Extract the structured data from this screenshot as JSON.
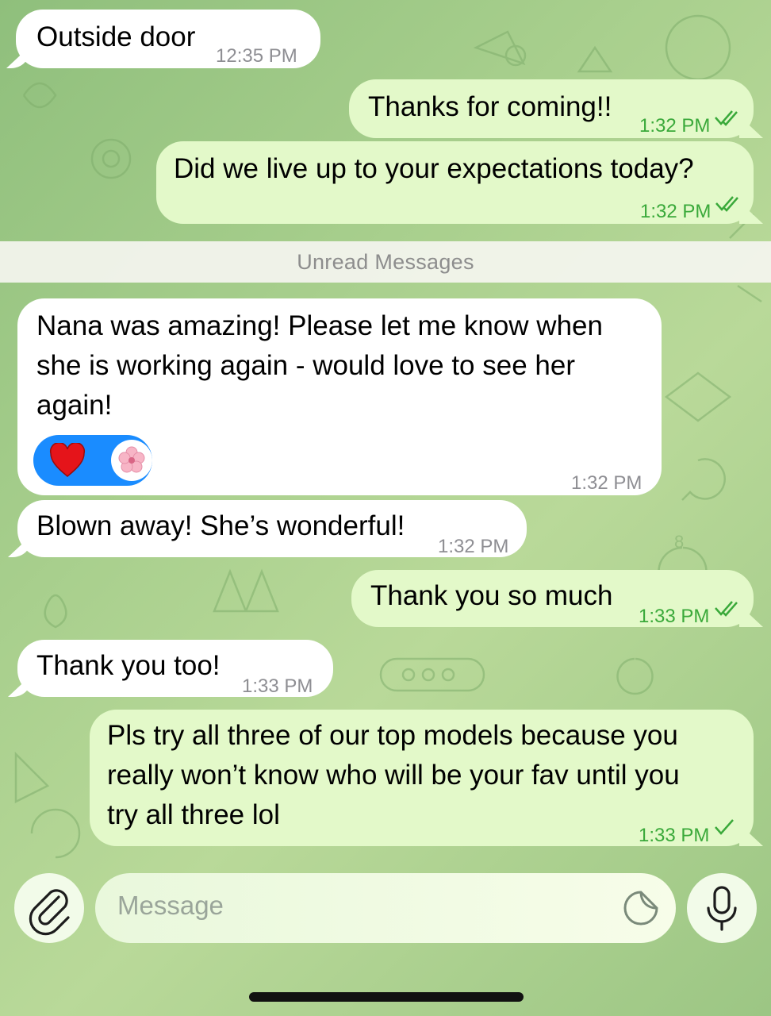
{
  "divider": {
    "label": "Unread Messages"
  },
  "messages": [
    {
      "text": "Outside door",
      "time": "12:35 PM"
    },
    {
      "text": "Thanks for coming!!",
      "time": "1:32 PM"
    },
    {
      "text": "Did we live up to your expectations today?",
      "time": "1:32 PM"
    },
    {
      "lines": [
        "Nana was amazing! Please let me know when",
        "she is working again - would love to see her",
        "again!"
      ],
      "time": "1:32 PM",
      "reactions": [
        "heart",
        "flower"
      ]
    },
    {
      "text": "Blown away! She’s wonderful!",
      "time": "1:32 PM"
    },
    {
      "text": "Thank you so much",
      "time": "1:33 PM"
    },
    {
      "text": "Thank you too!",
      "time": "1:33 PM"
    },
    {
      "lines": [
        "Pls try all three of our top models because you",
        "really won’t know who will be your fav until you",
        "try all three lol"
      ],
      "time": "1:33 PM"
    }
  ],
  "composer": {
    "placeholder": "Message"
  },
  "icons": [
    "paperclip-icon",
    "sticker-icon",
    "microphone-icon",
    "double-check-icon",
    "single-check-icon",
    "heart-icon",
    "cherry-blossom-icon"
  ],
  "colors": {
    "incoming": "#ffffff",
    "outgoing": "#e3f9c9",
    "timestamp_out": "#3aa93a",
    "reaction_pill": "#1a8cff"
  }
}
